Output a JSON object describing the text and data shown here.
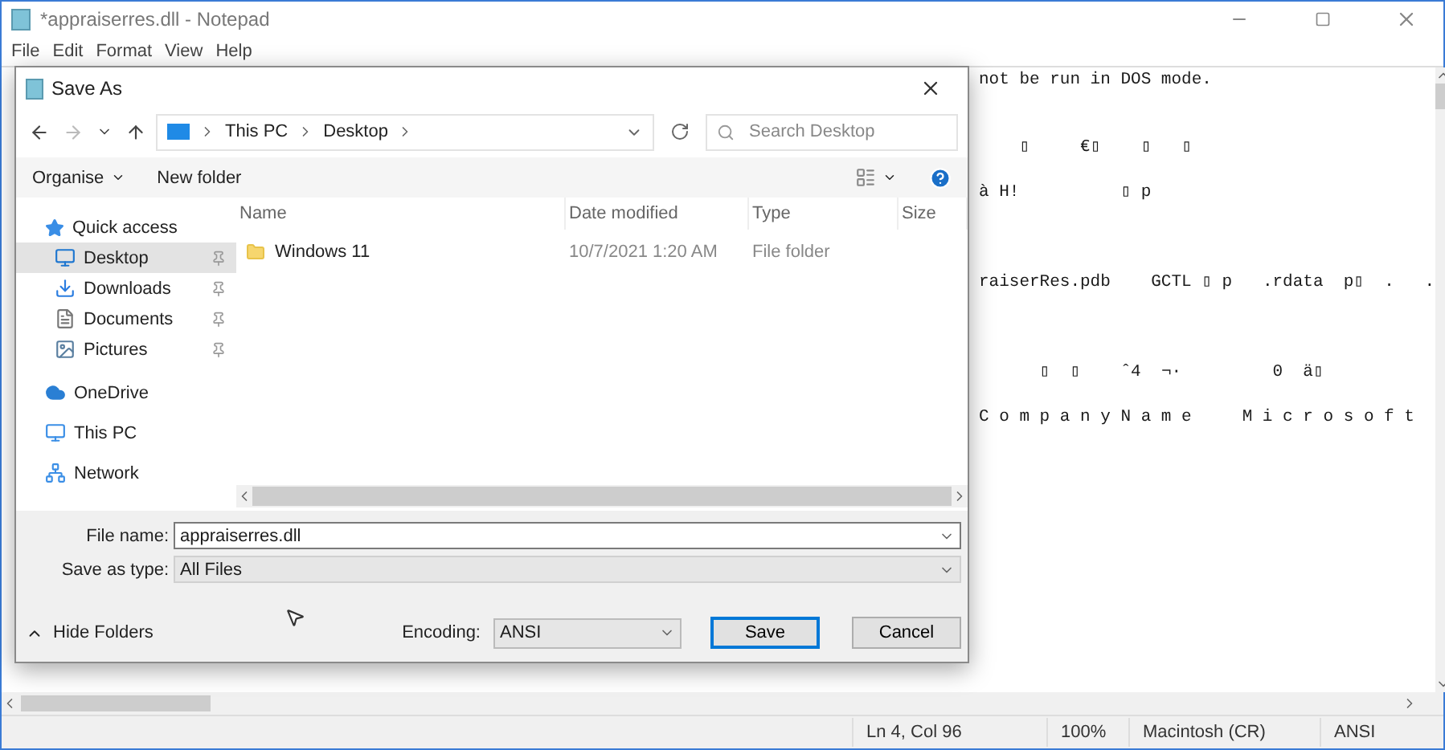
{
  "window": {
    "title": "*appraiserres.dll - Notepad"
  },
  "menu": [
    "File",
    "Edit",
    "Format",
    "View",
    "Help"
  ],
  "editor": {
    "lines": [
      "not be run in DOS mode.",
      "    ▯     €▯    ▯   ▯",
      "à H!          ▯ p",
      "raiserRes.pdb    GCTL ▯ p   .rdata  p▯  .   .",
      "      ▯  ▯    ˆ4  ¬·         0  ä▯",
      "C o m p a n y N a m e     M i c r o s o f t"
    ]
  },
  "dialog": {
    "title": "Save As",
    "breadcrumb": [
      "This PC",
      "Desktop"
    ],
    "search": {
      "placeholder": "Search Desktop"
    },
    "toolbar": {
      "organise": "Organise",
      "new_folder": "New folder"
    },
    "sidebar": [
      {
        "label": "Quick access",
        "kind": "star",
        "selected": false,
        "pinned": false,
        "children": [
          {
            "label": "Desktop",
            "kind": "monitor",
            "selected": true,
            "pinned": true
          },
          {
            "label": "Downloads",
            "kind": "download",
            "selected": false,
            "pinned": true
          },
          {
            "label": "Documents",
            "kind": "document",
            "selected": false,
            "pinned": true
          },
          {
            "label": "Pictures",
            "kind": "picture",
            "selected": false,
            "pinned": true
          }
        ]
      },
      {
        "label": "OneDrive",
        "kind": "cloud",
        "selected": false,
        "pinned": false
      },
      {
        "label": "This PC",
        "kind": "pc",
        "selected": false,
        "pinned": false
      },
      {
        "label": "Network",
        "kind": "network",
        "selected": false,
        "pinned": false
      }
    ],
    "columns": [
      "Name",
      "Date modified",
      "Type",
      "Size"
    ],
    "rows": [
      {
        "name": "Windows 11",
        "date": "10/7/2021 1:20 AM",
        "type": "File folder"
      }
    ],
    "file_name": {
      "label": "File name:",
      "value": "appraiserres.dll"
    },
    "save_type": {
      "label": "Save as type:",
      "value": "All Files"
    },
    "hide_folders": "Hide Folders",
    "encoding": {
      "label": "Encoding:",
      "value": "ANSI"
    },
    "buttons": [
      "Save",
      "Cancel"
    ]
  },
  "status_bar": {
    "position": "Ln 4, Col 96",
    "zoom": "100%",
    "line_ending": "Macintosh (CR)",
    "encoding": "ANSI"
  }
}
